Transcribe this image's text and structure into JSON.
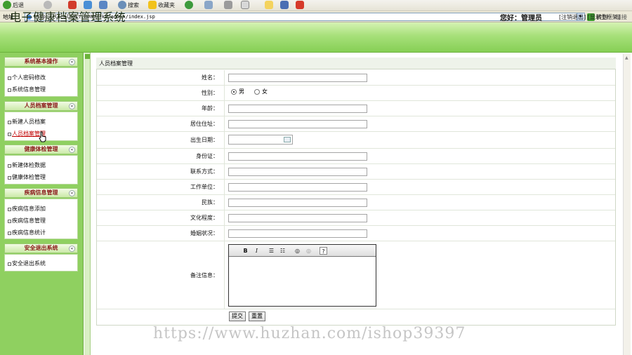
{
  "browser": {
    "toolbar": {
      "back_label": "后退",
      "search_label": "搜索",
      "favorites_label": "收藏夹"
    },
    "address": {
      "label": "地址",
      "url": "http://localhost:8083/jkd/admin/index.jsp",
      "go_label": "转到",
      "links_label": "链接"
    }
  },
  "header": {
    "title": "电子健康档案管理系统",
    "welcome": "您好：管理员",
    "links": "[注销退出] [显示主框架]"
  },
  "sidebar": {
    "groups": [
      {
        "title": "系统基本操作",
        "items": [
          "个人密码修改",
          "系统信息管理"
        ]
      },
      {
        "title": "人员档案管理",
        "items": [
          "新建人员档案",
          "人员档案管理"
        ],
        "active_index": 1
      },
      {
        "title": "健康体检管理",
        "items": [
          "新建体检数据",
          "健康体检管理"
        ]
      },
      {
        "title": "疾病信息管理",
        "items": [
          "疾病信息添加",
          "疾病信息管理",
          "疾病信息统计"
        ]
      },
      {
        "title": "安全退出系统",
        "items": [
          "安全退出系统"
        ]
      }
    ],
    "collapse_glyph": "«"
  },
  "form": {
    "title": "人员档案管理",
    "fields": {
      "name": "姓名：",
      "gender": "性别：",
      "age": "年龄：",
      "address": "居住住址：",
      "birth": "出生日期：",
      "id_card": "身份证：",
      "contact": "联系方式：",
      "work": "工作单位：",
      "ethnicity": "民族：",
      "education": "文化程度：",
      "marital": "婚姻状况：",
      "remarks": "备注信息："
    },
    "gender_options": {
      "male": "男",
      "female": "女",
      "selected": "男"
    },
    "editor_buttons": {
      "bold": "B",
      "italic": "I",
      "help": "?"
    },
    "submit_label": "提交",
    "reset_label": "重置"
  },
  "watermark": "https://www.huzhan.com/ishop39397"
}
